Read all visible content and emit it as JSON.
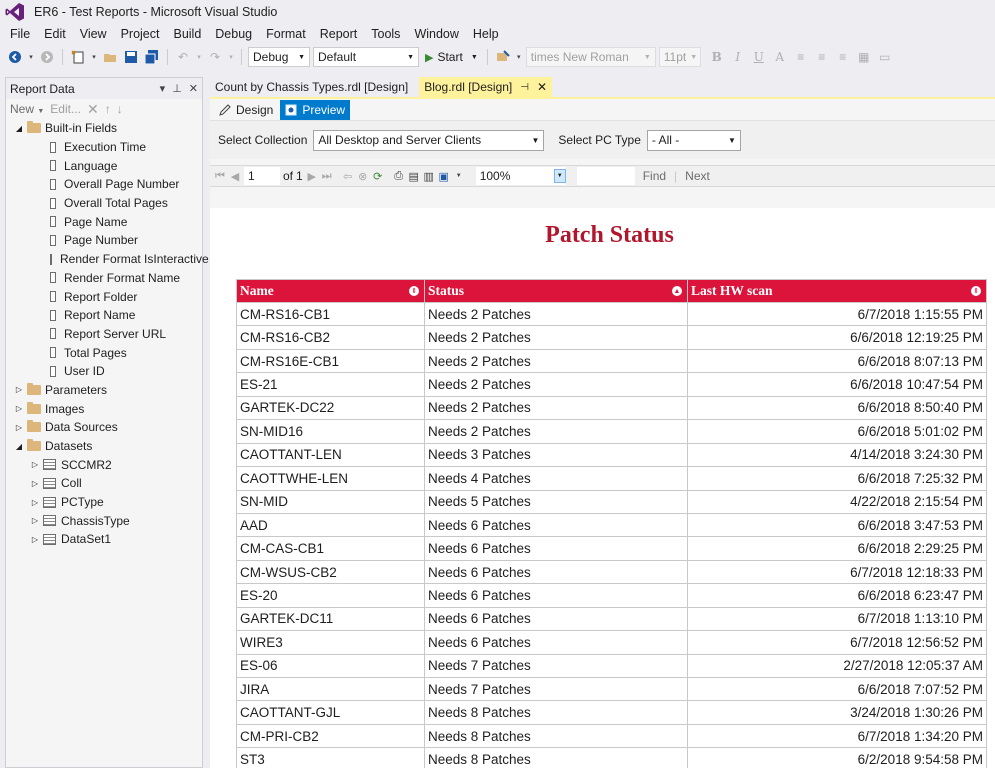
{
  "window": {
    "title": "ER6 - Test Reports - Microsoft Visual Studio"
  },
  "menu": [
    "File",
    "Edit",
    "View",
    "Project",
    "Build",
    "Debug",
    "Format",
    "Report",
    "Tools",
    "Window",
    "Help"
  ],
  "toolbar": {
    "config": "Debug",
    "platform": "Default",
    "start_label": "Start",
    "font_family": "times New Roman",
    "font_size": "11pt",
    "format_buttons": [
      "B",
      "I",
      "U",
      "A"
    ]
  },
  "report_data_panel": {
    "title": "Report Data",
    "toolbar": {
      "new_label": "New",
      "edit_label": "Edit..."
    },
    "builtin_label": "Built-in Fields",
    "builtin_fields": [
      "Execution Time",
      "Language",
      "Overall Page Number",
      "Overall Total Pages",
      "Page Name",
      "Page Number",
      "Render Format IsInteractive",
      "Render Format Name",
      "Report Folder",
      "Report Name",
      "Report Server URL",
      "Total Pages",
      "User ID"
    ],
    "folders": [
      "Parameters",
      "Images",
      "Data Sources"
    ],
    "datasets_label": "Datasets",
    "datasets": [
      "SCCMR2",
      "Coll",
      "PCType",
      "ChassisType",
      "DataSet1"
    ]
  },
  "doc_tabs": {
    "inactive": "Count by Chassis Types.rdl [Design]",
    "active": "Blog.rdl [Design]"
  },
  "view_tabs": {
    "design": "Design",
    "preview": "Preview"
  },
  "params": {
    "collection_label": "Select Collection",
    "collection_value": "All Desktop and Server Clients",
    "pctype_label": "Select PC Type",
    "pctype_value": "- All -"
  },
  "report_toolbar": {
    "page": "1",
    "of_label": "of",
    "total_pages": "1",
    "zoom": "100%",
    "find_label": "Find",
    "next_label": "Next"
  },
  "report": {
    "title": "Patch Status",
    "columns": [
      "Name",
      "Status",
      "Last HW scan"
    ],
    "rows": [
      [
        "CM-RS16-CB1",
        "Needs 2 Patches",
        "6/7/2018 1:15:55 PM"
      ],
      [
        "CM-RS16-CB2",
        "Needs 2 Patches",
        "6/6/2018 12:19:25 PM"
      ],
      [
        "CM-RS16E-CB1",
        "Needs 2 Patches",
        "6/6/2018 8:07:13 PM"
      ],
      [
        "ES-21",
        "Needs 2 Patches",
        "6/6/2018 10:47:54 PM"
      ],
      [
        "GARTEK-DC22",
        "Needs 2 Patches",
        "6/6/2018 8:50:40 PM"
      ],
      [
        "SN-MID16",
        "Needs 2 Patches",
        "6/6/2018 5:01:02 PM"
      ],
      [
        "CAOTTANT-LEN",
        "Needs 3 Patches",
        "4/14/2018 3:24:30 PM"
      ],
      [
        "CAOTTWHE-LEN",
        "Needs 4 Patches",
        "6/6/2018 7:25:32 PM"
      ],
      [
        "SN-MID",
        "Needs 5 Patches",
        "4/22/2018 2:15:54 PM"
      ],
      [
        "AAD",
        "Needs 6 Patches",
        "6/6/2018 3:47:53 PM"
      ],
      [
        "CM-CAS-CB1",
        "Needs 6 Patches",
        "6/6/2018 2:29:25 PM"
      ],
      [
        "CM-WSUS-CB2",
        "Needs 6 Patches",
        "6/7/2018 12:18:33 PM"
      ],
      [
        "ES-20",
        "Needs 6 Patches",
        "6/6/2018 6:23:47 PM"
      ],
      [
        "GARTEK-DC11",
        "Needs 6 Patches",
        "6/7/2018 1:13:10 PM"
      ],
      [
        "WIRE3",
        "Needs 6 Patches",
        "6/7/2018 12:56:52 PM"
      ],
      [
        "ES-06",
        "Needs 7 Patches",
        "2/27/2018 12:05:37 AM"
      ],
      [
        "JIRA",
        "Needs 7 Patches",
        "6/6/2018 7:07:52 PM"
      ],
      [
        "CAOTTANT-GJL",
        "Needs 8 Patches",
        "3/24/2018 1:30:26 PM"
      ],
      [
        "CM-PRI-CB2",
        "Needs 8 Patches",
        "6/7/2018 1:34:20 PM"
      ],
      [
        "ST3",
        "Needs 8 Patches",
        "6/2/2018 9:54:58 PM"
      ]
    ]
  },
  "colors": {
    "accent": "#007acc",
    "header_red": "#dc143c",
    "title_red": "#b0172d",
    "active_tab": "#fff29d"
  }
}
